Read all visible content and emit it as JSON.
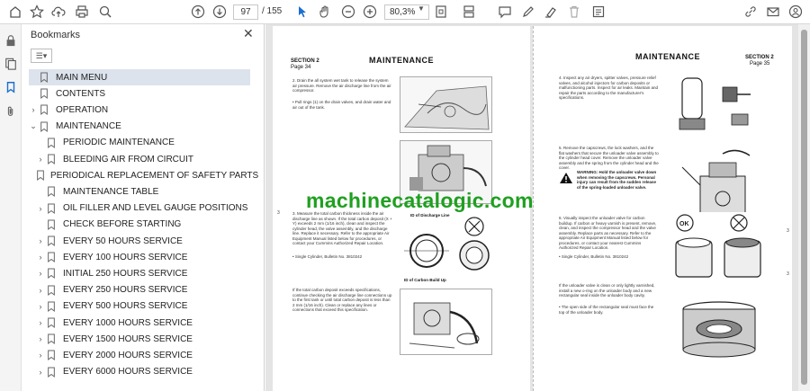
{
  "toolbar": {
    "page_current": "97",
    "page_total": "/ 155",
    "zoom": "80,3%"
  },
  "bookmarks_panel": {
    "title": "Bookmarks",
    "items": [
      {
        "label": "MAIN MENU",
        "expandable": false,
        "selected": true,
        "indent": 0
      },
      {
        "label": "CONTENTS",
        "expandable": false,
        "selected": false,
        "indent": 0
      },
      {
        "label": "OPERATION",
        "expandable": true,
        "expanded": false,
        "indent": 0
      },
      {
        "label": "MAINTENANCE",
        "expandable": true,
        "expanded": true,
        "indent": 0
      },
      {
        "label": "PERIODIC MAINTENANCE",
        "expandable": false,
        "indent": 1
      },
      {
        "label": "BLEEDING AIR FROM CIRCUIT",
        "expandable": true,
        "expanded": false,
        "indent": 1
      },
      {
        "label": "PERIODICAL REPLACEMENT OF SAFETY PARTS",
        "expandable": false,
        "indent": 1
      },
      {
        "label": "MAINTENANCE TABLE",
        "expandable": false,
        "indent": 1
      },
      {
        "label": "OIL FILLER AND LEVEL GAUGE POSITIONS",
        "expandable": true,
        "expanded": false,
        "indent": 1
      },
      {
        "label": "CHECK BEFORE STARTING",
        "expandable": false,
        "indent": 1
      },
      {
        "label": "EVERY 50 HOURS SERVICE",
        "expandable": true,
        "expanded": false,
        "indent": 1
      },
      {
        "label": "EVERY 100 HOURS SERVICE",
        "expandable": true,
        "expanded": false,
        "indent": 1
      },
      {
        "label": "INITIAL 250 HOURS SERVICE",
        "expandable": true,
        "expanded": false,
        "indent": 1
      },
      {
        "label": "EVERY 250 HOURS SERVICE",
        "expandable": true,
        "expanded": false,
        "indent": 1
      },
      {
        "label": "EVERY 500 HOURS SERVICE",
        "expandable": true,
        "expanded": false,
        "indent": 1
      },
      {
        "label": "EVERY 1000 HOURS SERVICE",
        "expandable": true,
        "expanded": false,
        "indent": 1
      },
      {
        "label": "EVERY 1500 HOURS SERVICE",
        "expandable": true,
        "expanded": false,
        "indent": 1
      },
      {
        "label": "EVERY 2000 HOURS SERVICE",
        "expandable": true,
        "expanded": false,
        "indent": 1
      },
      {
        "label": "EVERY 6000 HOURS SERVICE",
        "expandable": true,
        "expanded": false,
        "indent": 1
      }
    ]
  },
  "document": {
    "watermark": "machinecatalogic.com",
    "left_page": {
      "section": "SECTION 2",
      "page": "Page 34",
      "title": "MAINTENANCE",
      "para1": "2.  Drain the all system wet tank to release the system air pressure. Remove the air discharge line from the air compressor.",
      "para1b": "•  Pull rings (1) on the drain valves, and drain water and air out of the tank.",
      "para2": "3.  Measure the total carbon thickness inside the air discharge line as shown. If the total carbon deposit (X + Y) exceeds 2 mm (1/16 inch), clean and inspect the cylinder head, the valve assembly, and the discharge line. Replace it necessary. Refer to the appropriate Air Equipment Manual listed below for procedures, or contact your Cummins Authorized Repair Location.",
      "para2b": "•  Single Cylinder, Bulletin No. 3810242",
      "para3": "If the total carbon deposit exceeds specifications, continue checking the air discharge line connections up to the first tank or until total carbon deposit is less than 2 mm (1/16 inch). Clean or replace any lines or connections that exceed this specification.",
      "fig_label1": "ID of Discharge Line",
      "fig_label2": "ID of Carbon Build Up"
    },
    "right_page": {
      "section": "SECTION 2",
      "page": "Page 35",
      "title": "MAINTENANCE",
      "para4": "4.  Inspect any air dryers, spitter valves, pressure relief valves, and alcohol injectors for carbon deposits or malfunctioning parts. Inspect for air leaks. Maintain and repair the parts according to the manufacturer's specifications.",
      "para5": "5.  Remove the capscrews, the lock washers, and the flat washers that secure the unloader valve assembly to the cylinder head cover. Remove the unloader valve assembly and the spring from the cylinder head and the cover.",
      "warning": "WARNING: Hold the unloader valve down when removing the capscrews. Personal injury can result from the sudden release of the spring-loaded unloader valve.",
      "para6": "6.  Visually inspect the unloader valve for carbon buildup. If carbon or heavy varnish is present, remove, clean, and inspect the compressor head and the valve assembly. Replace parts as necessary. Refer to the appropriate Air Equipment Manual listed below for procedures, or contact your nearest Cummins Authorized Repair Location.",
      "para6b": "•  Single Cylinder, Bulletin No. 3810242",
      "para7": "If the unloader valve is clean or only lightly varnished, install a new o-ring on the unloader body and a new rectangular seal inside the unloader body cavity.",
      "para7b": "•  The open side of the rectangular seal must face the top of the unloader body."
    }
  }
}
